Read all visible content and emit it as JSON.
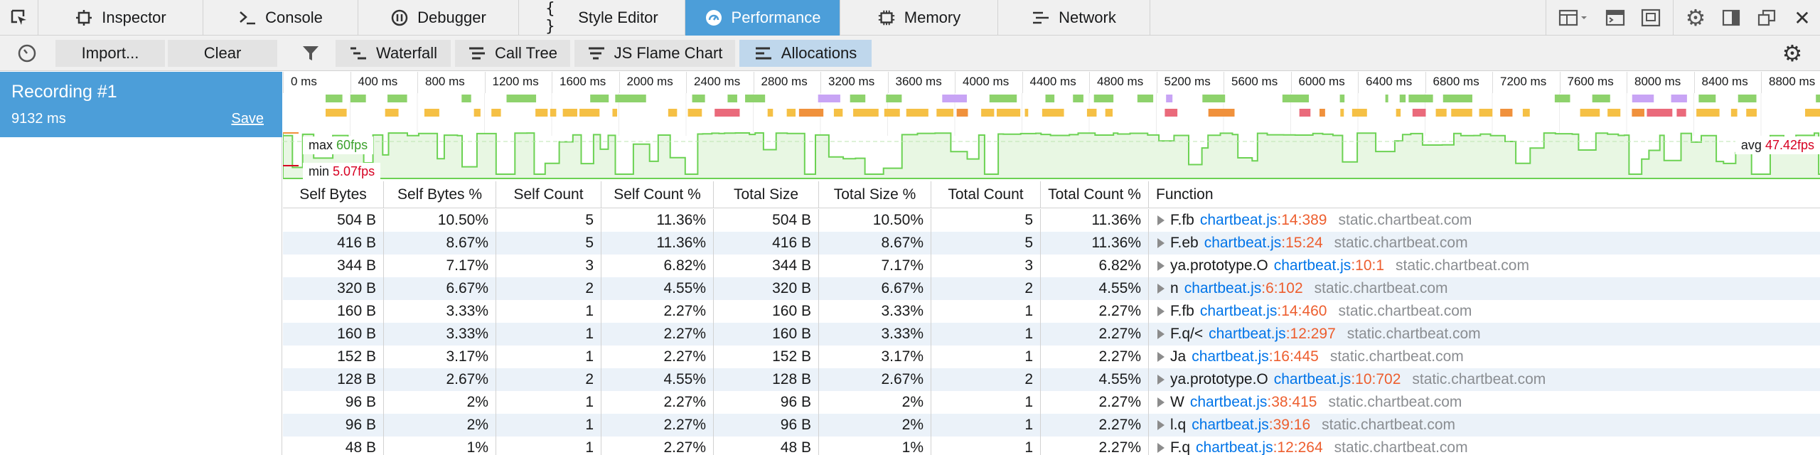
{
  "tabs": [
    {
      "label": "Inspector",
      "icon": "inspector-icon"
    },
    {
      "label": "Console",
      "icon": "console-icon"
    },
    {
      "label": "Debugger",
      "icon": "debugger-icon"
    },
    {
      "label": "Style Editor",
      "icon": "style-editor-icon"
    },
    {
      "label": "Performance",
      "icon": "performance-icon",
      "active": true
    },
    {
      "label": "Memory",
      "icon": "memory-icon"
    },
    {
      "label": "Network",
      "icon": "network-icon"
    }
  ],
  "toolbar": {
    "import_label": "Import...",
    "clear_label": "Clear",
    "views": {
      "waterfall": "Waterfall",
      "calltree": "Call Tree",
      "flame": "JS Flame Chart",
      "allocations": "Allocations"
    },
    "active_view": "Allocations"
  },
  "recording": {
    "title": "Recording #1",
    "duration": "9132 ms",
    "save_label": "Save"
  },
  "timeline": {
    "ticks": [
      "0 ms",
      "400 ms",
      "800 ms",
      "1200 ms",
      "1600 ms",
      "2000 ms",
      "2400 ms",
      "2800 ms",
      "3200 ms",
      "3600 ms",
      "4000 ms",
      "4400 ms",
      "4800 ms",
      "5200 ms",
      "5600 ms",
      "6000 ms",
      "6400 ms",
      "6800 ms",
      "7200 ms",
      "7600 ms",
      "8000 ms",
      "8400 ms",
      "8800 ms"
    ]
  },
  "fps": {
    "max_label": "max",
    "max_value": "60",
    "min_label": "min",
    "min_value": "5.07",
    "avg_label": "avg",
    "avg_value": "47.42",
    "unit": "fps"
  },
  "columns": [
    "Self Bytes",
    "Self Bytes %",
    "Self Count",
    "Self Count %",
    "Total Size",
    "Total Size %",
    "Total Count",
    "Total Count %",
    "Function"
  ],
  "rows": [
    {
      "self_bytes": "504 B",
      "self_bytes_pct": "10.50%",
      "self_count": "5",
      "self_count_pct": "11.36%",
      "total_size": "504 B",
      "total_size_pct": "10.50%",
      "total_count": "5",
      "total_count_pct": "11.36%",
      "fn": "F.fb",
      "file": "chartbeat.js",
      "loc": ":14:389",
      "host": "static.chartbeat.com"
    },
    {
      "self_bytes": "416 B",
      "self_bytes_pct": "8.67%",
      "self_count": "5",
      "self_count_pct": "11.36%",
      "total_size": "416 B",
      "total_size_pct": "8.67%",
      "total_count": "5",
      "total_count_pct": "11.36%",
      "fn": "F.eb",
      "file": "chartbeat.js",
      "loc": ":15:24",
      "host": "static.chartbeat.com"
    },
    {
      "self_bytes": "344 B",
      "self_bytes_pct": "7.17%",
      "self_count": "3",
      "self_count_pct": "6.82%",
      "total_size": "344 B",
      "total_size_pct": "7.17%",
      "total_count": "3",
      "total_count_pct": "6.82%",
      "fn": "ya.prototype.O",
      "file": "chartbeat.js",
      "loc": ":10:1",
      "host": "static.chartbeat.com"
    },
    {
      "self_bytes": "320 B",
      "self_bytes_pct": "6.67%",
      "self_count": "2",
      "self_count_pct": "4.55%",
      "total_size": "320 B",
      "total_size_pct": "6.67%",
      "total_count": "2",
      "total_count_pct": "4.55%",
      "fn": "n",
      "file": "chartbeat.js",
      "loc": ":6:102",
      "host": "static.chartbeat.com"
    },
    {
      "self_bytes": "160 B",
      "self_bytes_pct": "3.33%",
      "self_count": "1",
      "self_count_pct": "2.27%",
      "total_size": "160 B",
      "total_size_pct": "3.33%",
      "total_count": "1",
      "total_count_pct": "2.27%",
      "fn": "F.fb",
      "file": "chartbeat.js",
      "loc": ":14:460",
      "host": "static.chartbeat.com"
    },
    {
      "self_bytes": "160 B",
      "self_bytes_pct": "3.33%",
      "self_count": "1",
      "self_count_pct": "2.27%",
      "total_size": "160 B",
      "total_size_pct": "3.33%",
      "total_count": "1",
      "total_count_pct": "2.27%",
      "fn": "F.q/<",
      "file": "chartbeat.js",
      "loc": ":12:297",
      "host": "static.chartbeat.com"
    },
    {
      "self_bytes": "152 B",
      "self_bytes_pct": "3.17%",
      "self_count": "1",
      "self_count_pct": "2.27%",
      "total_size": "152 B",
      "total_size_pct": "3.17%",
      "total_count": "1",
      "total_count_pct": "2.27%",
      "fn": "Ja",
      "file": "chartbeat.js",
      "loc": ":16:445",
      "host": "static.chartbeat.com"
    },
    {
      "self_bytes": "128 B",
      "self_bytes_pct": "2.67%",
      "self_count": "2",
      "self_count_pct": "4.55%",
      "total_size": "128 B",
      "total_size_pct": "2.67%",
      "total_count": "2",
      "total_count_pct": "4.55%",
      "fn": "ya.prototype.O",
      "file": "chartbeat.js",
      "loc": ":10:702",
      "host": "static.chartbeat.com"
    },
    {
      "self_bytes": "96 B",
      "self_bytes_pct": "2%",
      "self_count": "1",
      "self_count_pct": "2.27%",
      "total_size": "96 B",
      "total_size_pct": "2%",
      "total_count": "1",
      "total_count_pct": "2.27%",
      "fn": "W",
      "file": "chartbeat.js",
      "loc": ":38:415",
      "host": "static.chartbeat.com"
    },
    {
      "self_bytes": "96 B",
      "self_bytes_pct": "2%",
      "self_count": "1",
      "self_count_pct": "2.27%",
      "total_size": "96 B",
      "total_size_pct": "2%",
      "total_count": "1",
      "total_count_pct": "2.27%",
      "fn": "l.q",
      "file": "chartbeat.js",
      "loc": ":39:16",
      "host": "static.chartbeat.com"
    },
    {
      "self_bytes": "48 B",
      "self_bytes_pct": "1%",
      "self_count": "1",
      "self_count_pct": "2.27%",
      "total_size": "48 B",
      "total_size_pct": "1%",
      "total_count": "1",
      "total_count_pct": "2.27%",
      "fn": "F.q",
      "file": "chartbeat.js",
      "loc": ":12:264",
      "host": "static.chartbeat.com"
    }
  ],
  "colors": {
    "accent": "#4c9ed9",
    "fps_line": "#6cd253",
    "marker_green": "#8ed26c",
    "marker_yellow": "#f5c045",
    "marker_orange": "#f0913c",
    "marker_red": "#ea6a7b",
    "marker_purple": "#c8a4f5"
  }
}
